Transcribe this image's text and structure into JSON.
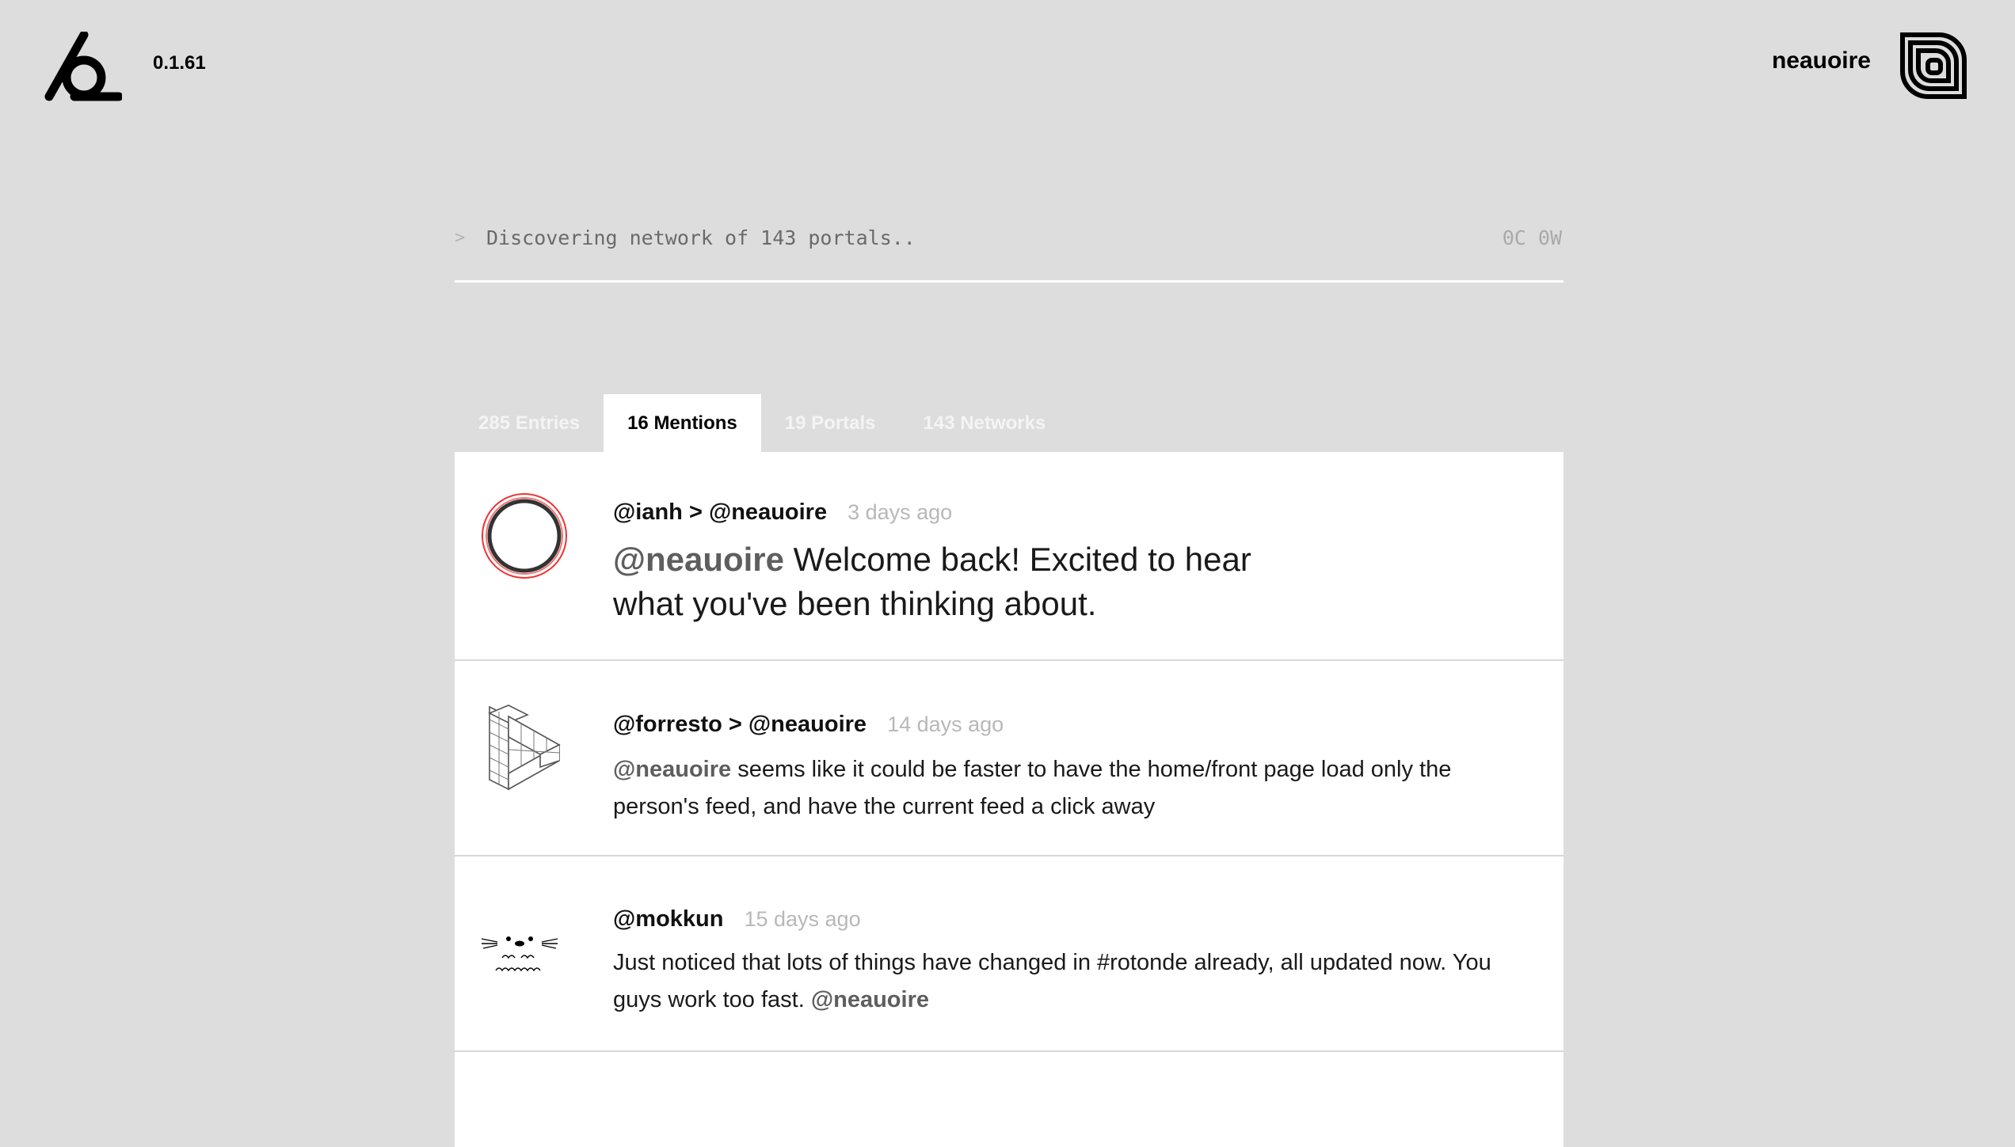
{
  "header": {
    "version": "0.1.61",
    "username": "neauoire"
  },
  "command": {
    "prompt": ">",
    "status": "Discovering network of 143 portals..",
    "counts": "0C 0W"
  },
  "tabs": [
    {
      "label": "285 Entries",
      "active": false
    },
    {
      "label": "16 Mentions",
      "active": true
    },
    {
      "label": "19 Portals",
      "active": false
    },
    {
      "label": "143 Networks",
      "active": false
    }
  ],
  "entries": [
    {
      "handle": "@ianh > @neauoire",
      "time": "3 days ago",
      "mention": "@neauoire",
      "text": " Welcome back! Excited to hear what you've been thinking about.",
      "avatar_icon": "circle-ring-icon"
    },
    {
      "handle": "@forresto > @neauoire",
      "time": "14 days ago",
      "mention": "@neauoire",
      "text": " seems like it could be faster to have the home/front page load only the person's feed, and have the current feed a click away",
      "avatar_icon": "cube-triangle-icon"
    },
    {
      "handle": "@mokkun",
      "time": "15 days ago",
      "text": "Just noticed that lots of things have changed in #rotonde already, all updated now. You guys work too fast. ",
      "mention": "@neauoire",
      "avatar_icon": "cat-face-icon"
    }
  ]
}
